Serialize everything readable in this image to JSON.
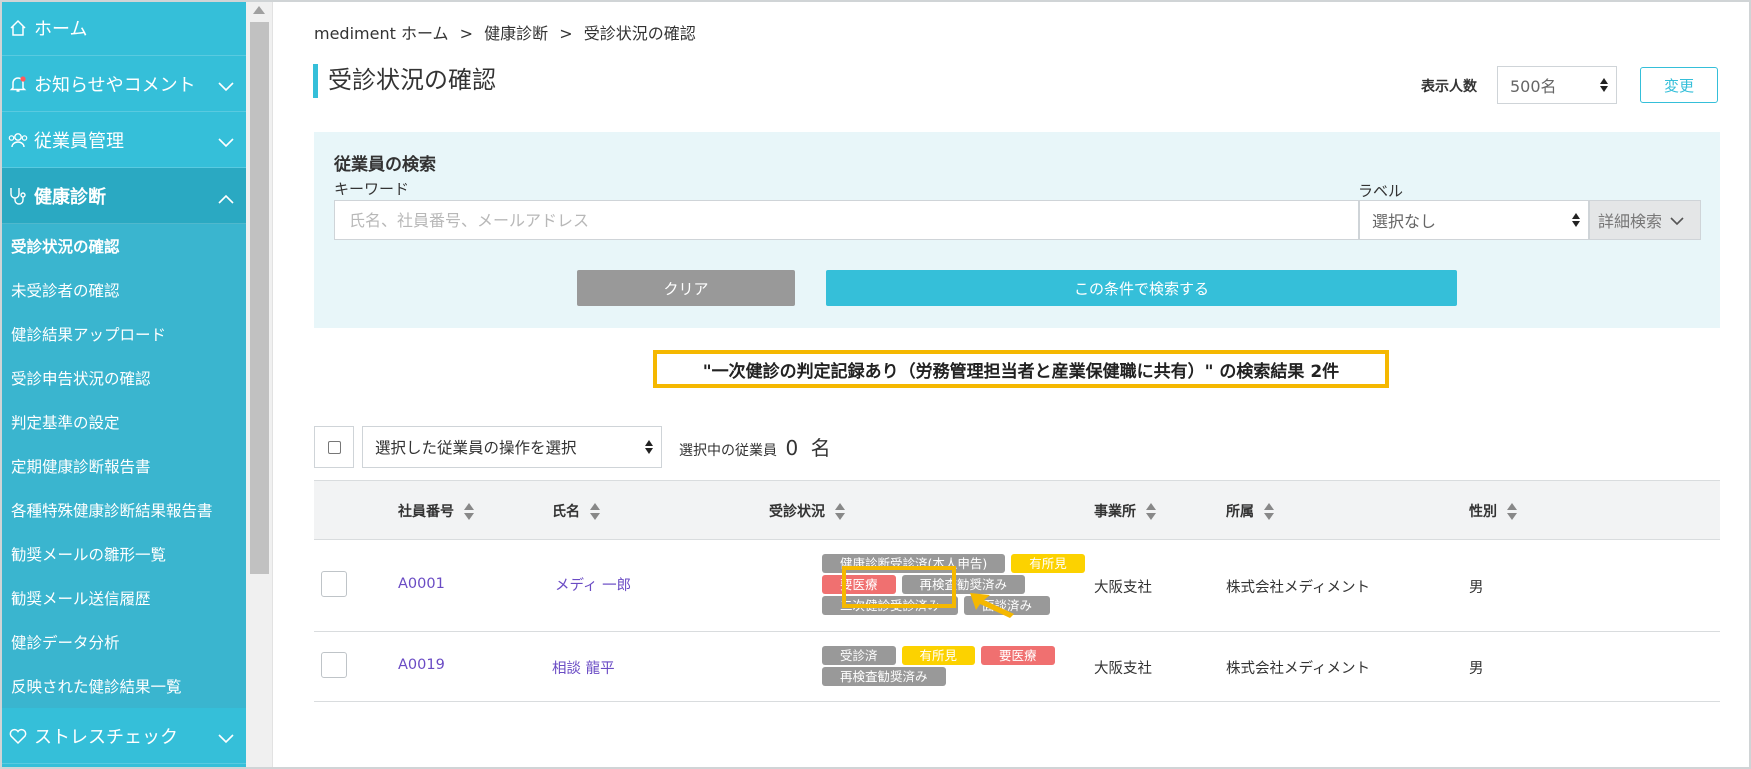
{
  "sidebar": {
    "items": [
      {
        "label": "ホーム",
        "icon": "home-icon"
      },
      {
        "label": "お知らせやコメント",
        "icon": "bell-icon"
      },
      {
        "label": "従業員管理",
        "icon": "users-icon"
      },
      {
        "label": "健康診断",
        "icon": "stethoscope-icon"
      }
    ],
    "sub_items": [
      "受診状況の確認",
      "未受診者の確認",
      "健診結果アップロード",
      "受診申告状況の確認",
      "判定基準の設定",
      "定期健康診断報告書",
      "各種特殊健康診断結果報告書",
      "勧奨メールの雛形一覧",
      "勧奨メール送信履歴",
      "健診データ分析",
      "反映された健診結果一覧"
    ],
    "bottom_item": {
      "label": "ストレスチェック",
      "icon": "heart-icon"
    }
  },
  "breadcrumb": {
    "home": "mediment ホーム",
    "sep1": ">",
    "section": "健康診断",
    "sep2": ">",
    "current": "受診状況の確認"
  },
  "page_title": "受診状況の確認",
  "display": {
    "label": "表示人数",
    "value": "500名",
    "change_button": "変更"
  },
  "search": {
    "title": "従業員の検索",
    "keyword_label": "キーワード",
    "keyword_placeholder": "氏名、社員番号、メールアドレス",
    "label_label": "ラベル",
    "label_value": "選択なし",
    "detail_button": "詳細検索",
    "clear_button": "クリア",
    "search_button": "この条件で検索する"
  },
  "result_summary": "\"一次健診の判定記録あり（労務管理担当者と産業保健職に共有）\" の検索結果 2件",
  "bulk": {
    "operation_placeholder": "選択した従業員の操作を選択",
    "selected_label": "選択中の従業員",
    "selected_count": "0",
    "selected_unit": "名"
  },
  "table": {
    "headers": {
      "employee_id": "社員番号",
      "name": "氏名",
      "status": "受診状況",
      "office": "事業所",
      "department": "所属",
      "gender": "性別"
    },
    "rows": [
      {
        "employee_id": "A0001",
        "name": "メディ 一郎",
        "tags": [
          {
            "text": "健康診断受診済(本人申告)",
            "color": "gray"
          },
          {
            "text": "有所見",
            "color": "yellow"
          },
          {
            "text": "要医療",
            "color": "red"
          },
          {
            "text": "再検査勧奨済み",
            "color": "gray"
          },
          {
            "text": "二次健診受診済み",
            "color": "gray"
          },
          {
            "text": "面談済み",
            "color": "gray"
          }
        ],
        "office": "大阪支社",
        "department": "株式会社メディメント",
        "gender": "男"
      },
      {
        "employee_id": "A0019",
        "name": "相談 龍平",
        "tags": [
          {
            "text": "受診済",
            "color": "gray"
          },
          {
            "text": "有所見",
            "color": "yellow"
          },
          {
            "text": "要医療",
            "color": "red"
          },
          {
            "text": "再検査勧奨済み",
            "color": "gray"
          }
        ],
        "office": "大阪支社",
        "department": "株式会社メディメント",
        "gender": "男"
      }
    ]
  },
  "colors": {
    "accent": "#35bfd9",
    "highlight": "#f5b800",
    "tag_gray": "#999999",
    "tag_yellow": "#fcd200",
    "tag_red": "#f07070",
    "link": "#6a4bc4"
  }
}
